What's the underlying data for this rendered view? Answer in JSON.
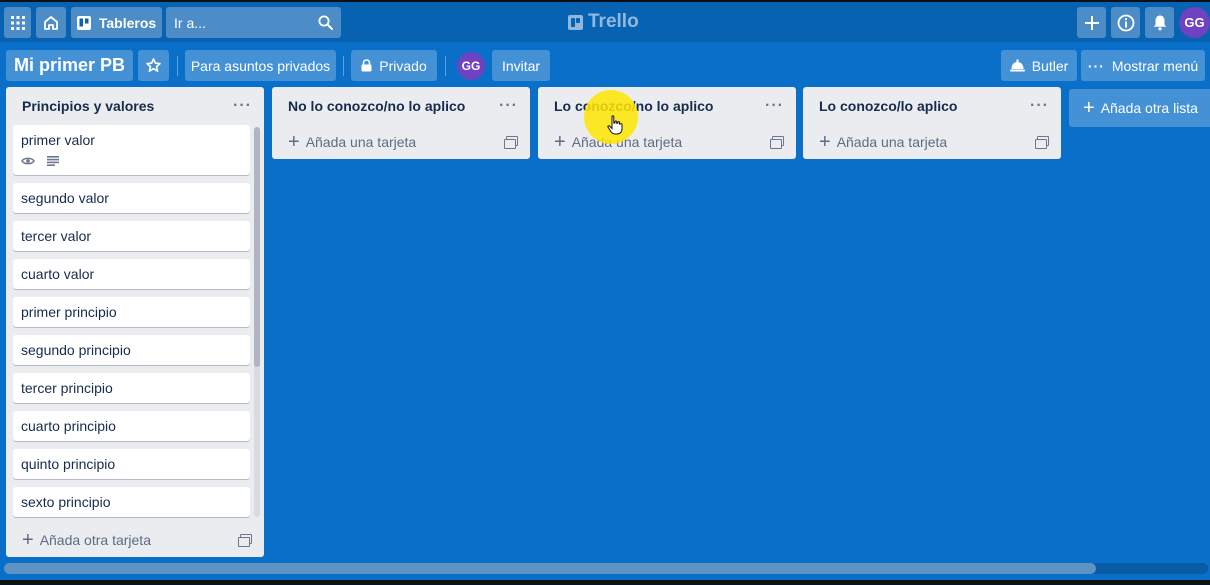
{
  "topbar": {
    "apps_icon": "grid-icon",
    "home_icon": "home-icon",
    "boards_label": "Tableros",
    "search_placeholder": "Ir a...",
    "logo_text": "Trello",
    "avatar_initials": "GG"
  },
  "board": {
    "title": "Mi primer PB",
    "team_label": "Para asuntos privados",
    "visibility_label": "Privado",
    "member_initials": "GG",
    "invite_label": "Invitar",
    "butler_label": "Butler",
    "menu_label": "Mostrar menú",
    "add_list_label": "Añada otra lista",
    "background_color": "#0a6fc9"
  },
  "lists": [
    {
      "title": "Principios y valores",
      "cards": [
        "primer valor",
        "segundo valor",
        "tercer valor",
        "cuarto valor",
        "primer principio",
        "segundo principio",
        "tercer principio",
        "cuarto principio",
        "quinto principio",
        "sexto principio"
      ],
      "add_label": "Añada otra tarjeta"
    },
    {
      "title": "No lo conozco/no lo aplico",
      "cards": [],
      "add_label": "Añada una tarjeta"
    },
    {
      "title": "Lo conozco/no lo aplico",
      "cards": [],
      "add_label": "Añada una tarjeta"
    },
    {
      "title": "Lo conozco/lo aplico",
      "cards": [],
      "add_label": "Añada una tarjeta"
    }
  ]
}
